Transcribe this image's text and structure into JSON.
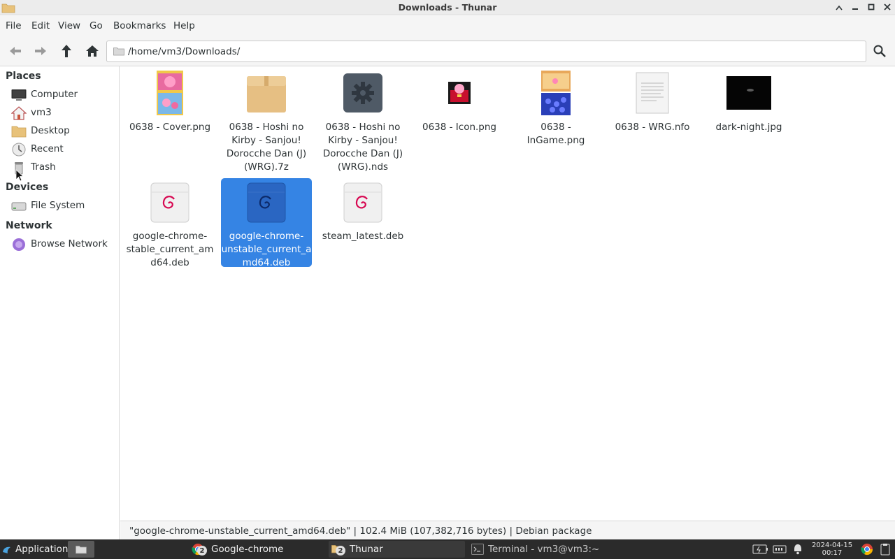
{
  "window": {
    "title": "Downloads - Thunar",
    "buttons": [
      "keep-above",
      "minimize",
      "maximize",
      "close"
    ]
  },
  "menubar": [
    "File",
    "Edit",
    "View",
    "Go",
    "Bookmarks",
    "Help"
  ],
  "toolbar": {
    "path": "/home/vm3/Downloads/"
  },
  "sidebar": {
    "places_header": "Places",
    "places": [
      {
        "label": "Computer",
        "icon": "computer-icon"
      },
      {
        "label": "vm3",
        "icon": "home-icon"
      },
      {
        "label": "Desktop",
        "icon": "folder-icon"
      },
      {
        "label": "Recent",
        "icon": "recent-icon"
      },
      {
        "label": "Trash",
        "icon": "trash-icon"
      }
    ],
    "devices_header": "Devices",
    "devices": [
      {
        "label": "File System",
        "icon": "drive-icon"
      }
    ],
    "network_header": "Network",
    "network": [
      {
        "label": "Browse Network",
        "icon": "network-icon"
      }
    ]
  },
  "files": [
    {
      "name": "0638 - Cover.png",
      "icon": "cover-image-thumbnail"
    },
    {
      "name": "0638 - Hoshi no Kirby - Sanjou! Dorocche Dan (J) (WRG).7z",
      "icon": "archive-icon"
    },
    {
      "name": "0638 - Hoshi no Kirby - Sanjou! Dorocche Dan (J) (WRG).nds",
      "icon": "executable-gear-icon"
    },
    {
      "name": "0638 - Icon.png",
      "icon": "icon-image-thumbnail"
    },
    {
      "name": "0638 - InGame.png",
      "icon": "ingame-image-thumbnail"
    },
    {
      "name": "0638 - WRG.nfo",
      "icon": "text-document-icon"
    },
    {
      "name": "dark-night.jpg",
      "icon": "dark-image-thumbnail"
    },
    {
      "name": "google-chrome-stable_current_amd64.deb",
      "icon": "debian-package-icon"
    },
    {
      "name": "google-chrome-unstable_current_amd64.deb",
      "icon": "debian-package-icon",
      "selected": true
    },
    {
      "name": "steam_latest.deb",
      "icon": "debian-package-icon"
    }
  ],
  "statusbar": {
    "text": "\"google-chrome-unstable_current_amd64.deb\"  |  102.4 MiB (107,382,716 bytes)  |  Debian package"
  },
  "taskbar": {
    "applications_label": "Applications",
    "items": [
      {
        "label": "Google-chrome",
        "count": "2"
      },
      {
        "label": "Thunar",
        "count": "2"
      },
      {
        "label": "Terminal - vm3@vm3:~"
      }
    ],
    "clock_date": "2024-04-15",
    "clock_time": "00:17"
  },
  "colors": {
    "selection": "#3584e4",
    "taskbar": "#2b2b2b",
    "debian_red": "#d70751"
  }
}
